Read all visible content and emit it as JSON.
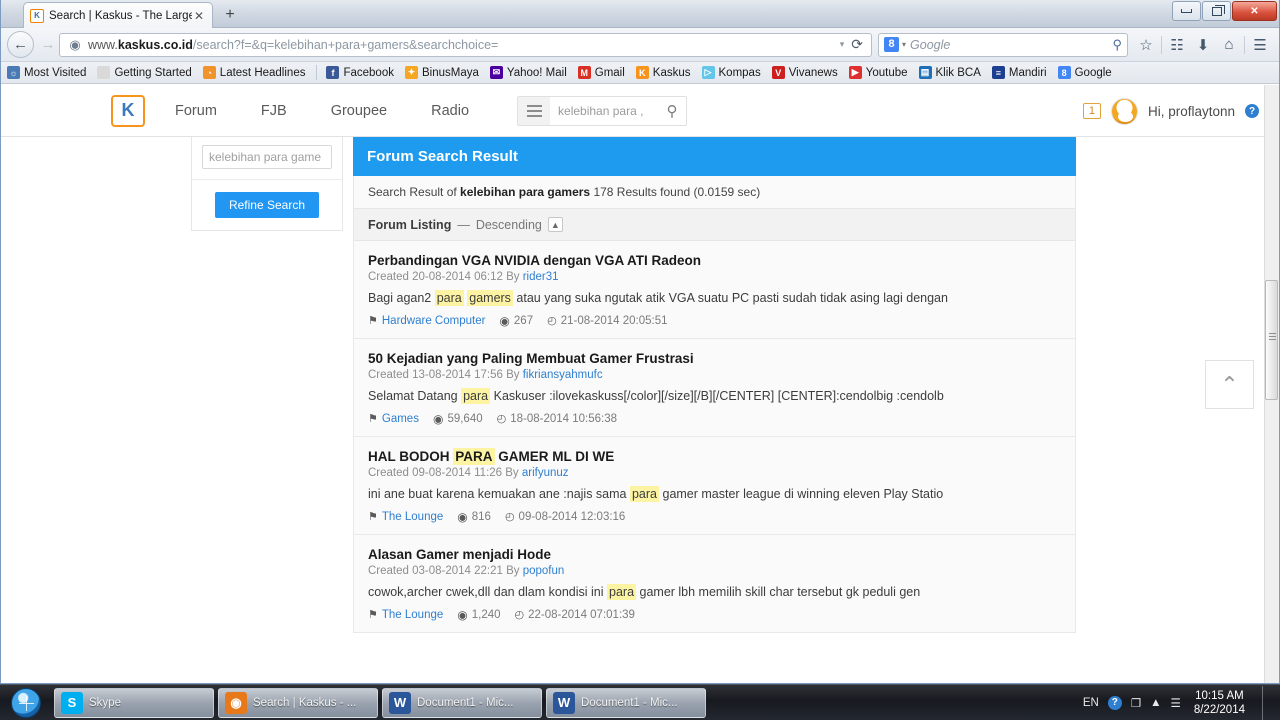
{
  "browser": {
    "tab": {
      "title": "Search | Kaskus - The Large...",
      "favicon": "kaskus-favicon",
      "close": "✕"
    },
    "newtab_label": "+",
    "window_controls": {
      "minimize": "minimize",
      "restore": "restore",
      "close": "✕"
    },
    "nav": {
      "back": "←",
      "forward": "→",
      "reload": "⟳",
      "dropdown": "▾"
    },
    "url": {
      "prefix": "www.",
      "domain": "kaskus.co.id",
      "path": "/search?f=&q=kelebihan+para+gamers&searchchoice="
    },
    "search": {
      "engine": "Google",
      "engine_icon": "8",
      "placeholder": "Google",
      "caret": "▾",
      "magnifier": "⚲"
    },
    "toolbar_icons": [
      {
        "name": "bookmark-star-icon",
        "glyph": "☆"
      },
      {
        "name": "reading-list-icon",
        "glyph": "☷"
      },
      {
        "name": "downloads-icon",
        "glyph": "⬇"
      },
      {
        "name": "home-icon",
        "glyph": "⌂"
      },
      {
        "name": "menu-icon",
        "glyph": "☰"
      }
    ],
    "bookmarks": [
      {
        "label": "Most Visited",
        "icon": "globe-icon",
        "glyph": "☼",
        "color": "#4a7ab5"
      },
      {
        "label": "Getting Started",
        "icon": "dotted-box-icon",
        "glyph": "",
        "color": "#d9d9d9"
      },
      {
        "label": "Latest Headlines",
        "icon": "rss-icon",
        "glyph": "◔",
        "color": "#f0932b"
      },
      {
        "separator": true
      },
      {
        "label": "Facebook",
        "icon": "facebook-icon",
        "glyph": "f",
        "color": "#3b5998"
      },
      {
        "label": "BinusMaya",
        "icon": "binusmaya-icon",
        "glyph": "✦",
        "color": "#f5a623"
      },
      {
        "label": "Yahoo! Mail",
        "icon": "yahoo-mail-icon",
        "glyph": "✉",
        "color": "#4a00a0"
      },
      {
        "label": "Gmail",
        "icon": "gmail-icon",
        "glyph": "M",
        "color": "#d93025"
      },
      {
        "label": "Kaskus",
        "icon": "kaskus-icon",
        "glyph": "K",
        "color": "#f7941e"
      },
      {
        "label": "Kompas",
        "icon": "kompas-icon",
        "glyph": "▷",
        "color": "#63c5e8"
      },
      {
        "label": "Vivanews",
        "icon": "vivanews-icon",
        "glyph": "V",
        "color": "#cc1f1f"
      },
      {
        "label": "Youtube",
        "icon": "youtube-icon",
        "glyph": "▶",
        "color": "#e02f2f"
      },
      {
        "label": "Klik BCA",
        "icon": "klikbca-icon",
        "glyph": "▤",
        "color": "#1d6fb8"
      },
      {
        "label": "Mandiri",
        "icon": "mandiri-icon",
        "glyph": "≡",
        "color": "#1d3f8f"
      },
      {
        "label": "Google",
        "icon": "google-icon",
        "glyph": "8",
        "color": "#4285f4"
      }
    ]
  },
  "site": {
    "logo_letter": "K",
    "nav_items": [
      {
        "label": "Forum"
      },
      {
        "label": "FJB"
      },
      {
        "label": "Groupee"
      },
      {
        "label": "Radio"
      }
    ],
    "header_search": {
      "value": "kelebihan para ,",
      "magnifier": "⚲",
      "menu": "hamburger-icon"
    },
    "notification_count": "1",
    "greeting": "Hi, proflaytonn",
    "help_glyph": "?"
  },
  "sidebar": {
    "refine_input_value": "kelebihan para game",
    "refine_button_label": "Refine Search"
  },
  "results_panel": {
    "header": "Forum Search Result",
    "summary_prefix": "Search Result of ",
    "summary_query": "kelebihan para gamers",
    "summary_suffix": " 178 Results found (0.0159 sec)",
    "listing_title": "Forum Listing",
    "listing_dash": " — ",
    "listing_sort": "Descending",
    "sort_toggle_glyph": "▲"
  },
  "results": [
    {
      "title": "Perbandingan VGA NVIDIA dengan VGA ATI Radeon",
      "created_label": "Created",
      "created_date": "20-08-2014 06:12",
      "by_label": "By",
      "author": "rider31",
      "snippet_parts": [
        {
          "t": "Bagi agan2 ",
          "hl": false
        },
        {
          "t": "para",
          "hl": true
        },
        {
          "t": " ",
          "hl": false
        },
        {
          "t": "gamers",
          "hl": true
        },
        {
          "t": " atau yang suka ngutak atik VGA suatu PC pasti sudah tidak asing lagi dengan",
          "hl": false
        }
      ],
      "forum": "Hardware Computer",
      "views": "267",
      "last_post": "21-08-2014 20:05:51"
    },
    {
      "title": "50 Kejadian yang Paling Membuat Gamer Frustrasi",
      "created_label": "Created",
      "created_date": "13-08-2014 17:56",
      "by_label": "By",
      "author": "fikriansyahmufc",
      "snippet_parts": [
        {
          "t": "Selamat Datang ",
          "hl": false
        },
        {
          "t": "para",
          "hl": true
        },
        {
          "t": " Kaskuser :ilovekaskuss[/color][/size][/B][/CENTER] [CENTER]:cendolbig :cendolb",
          "hl": false
        }
      ],
      "forum": "Games",
      "views": "59,640",
      "last_post": "18-08-2014 10:56:38"
    },
    {
      "title_parts": [
        {
          "t": "HAL BODOH ",
          "hl": false
        },
        {
          "t": "PARA",
          "hl": true
        },
        {
          "t": " GAMER ML DI WE",
          "hl": false
        }
      ],
      "title": "HAL BODOH PARA GAMER ML DI WE",
      "created_label": "Created",
      "created_date": "09-08-2014 11:26",
      "by_label": "By",
      "author": "arifyunuz",
      "snippet_parts": [
        {
          "t": "ini ane buat karena kemuakan ane :najis sama ",
          "hl": false
        },
        {
          "t": "para",
          "hl": true
        },
        {
          "t": " gamer master league di winning eleven Play Statio",
          "hl": false
        }
      ],
      "forum": "The Lounge",
      "views": "816",
      "last_post": "09-08-2014 12:03:16"
    },
    {
      "title": "Alasan Gamer menjadi Hode",
      "created_label": "Created",
      "created_date": "03-08-2014 22:21",
      "by_label": "By",
      "author": "popofun",
      "snippet_parts": [
        {
          "t": "cowok,archer cwek,dll dan dlam kondisi ini ",
          "hl": false
        },
        {
          "t": "para",
          "hl": true
        },
        {
          "t": " gamer lbh memilih skill char tersebut gk peduli gen",
          "hl": false
        }
      ],
      "forum": "The Lounge",
      "views": "1,240",
      "last_post": "22-08-2014 07:01:39"
    }
  ],
  "scroll_top_glyph": "⌃",
  "taskbar": {
    "start_label": "start",
    "items": [
      {
        "label": "Skype",
        "icon": "skype-icon",
        "glyph": "S",
        "color": "#00aff0"
      },
      {
        "label": "Search | Kaskus - ...",
        "icon": "firefox-icon",
        "glyph": "◉",
        "color": "#e8791a"
      },
      {
        "label": "Document1 - Mic...",
        "icon": "word-icon",
        "glyph": "W",
        "color": "#2b579a"
      },
      {
        "label": "Document1 - Mic...",
        "icon": "word-icon",
        "glyph": "W",
        "color": "#2b579a"
      }
    ],
    "tray": {
      "language": "EN",
      "help_glyph": "?",
      "network_glyph": "❐",
      "arrow_glyph": "▲",
      "action_glyph": "☰",
      "time": "10:15 AM",
      "date": "8/22/2014"
    }
  },
  "colors": {
    "accent_blue": "#1e9bef",
    "kaskus_orange": "#f7941e",
    "link_blue": "#2f7fd0",
    "highlight_yellow": "#fdf4a3"
  }
}
